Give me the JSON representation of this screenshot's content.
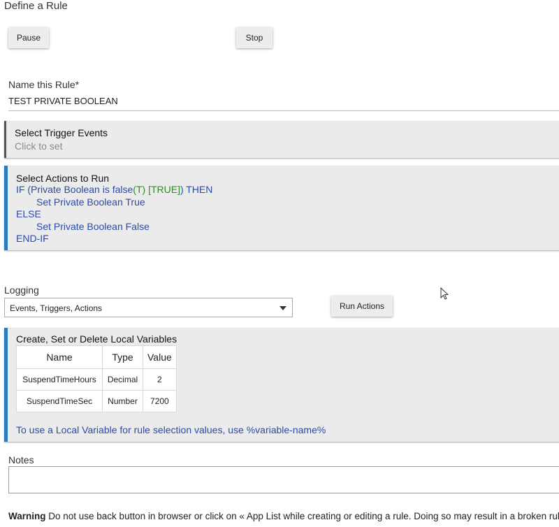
{
  "page": {
    "title": "Define a Rule"
  },
  "controls": {
    "pause_label": "Pause",
    "stop_label": "Stop"
  },
  "rule_name": {
    "label": "Name this Rule*",
    "value": "TEST PRIVATE BOOLEAN"
  },
  "triggers": {
    "title": "Select Trigger Events",
    "subtitle": "Click to set"
  },
  "actions": {
    "title": "Select Actions to Run",
    "if_prefix": "IF (Private Boolean is false",
    "if_truth": "(T) [TRUE]",
    "if_suffix": ") THEN",
    "then_action": "Set Private Boolean True",
    "else_label": "ELSE",
    "else_action": "Set Private Boolean False",
    "end_label": "END-IF"
  },
  "logging": {
    "label": "Logging",
    "selected": "Events, Triggers, Actions"
  },
  "run_actions_label": "Run Actions",
  "local_vars": {
    "title": "Create, Set or Delete Local Variables",
    "columns": [
      "Name",
      "Type",
      "Value"
    ],
    "rows": [
      [
        "SuspendTimeHours",
        "Decimal",
        "2"
      ],
      [
        "SuspendTimeSec",
        "Number",
        "7200"
      ]
    ],
    "hint": "To use a Local Variable for rule selection values, use %variable-name%"
  },
  "notes": {
    "label": "Notes",
    "value": ""
  },
  "warning": {
    "bold": "Warning",
    "text": " Do not use back button in browser or click on « App List while creating or editing a rule. Doing so may result in a broken rule."
  },
  "colors": {
    "accent_blue": "#2a7ac0",
    "action_text": "#2b4aa8",
    "truth_green": "#2f8a2a"
  },
  "icons": {
    "dropdown": "caret-down-icon",
    "pointer": "mouse-pointer-icon"
  }
}
